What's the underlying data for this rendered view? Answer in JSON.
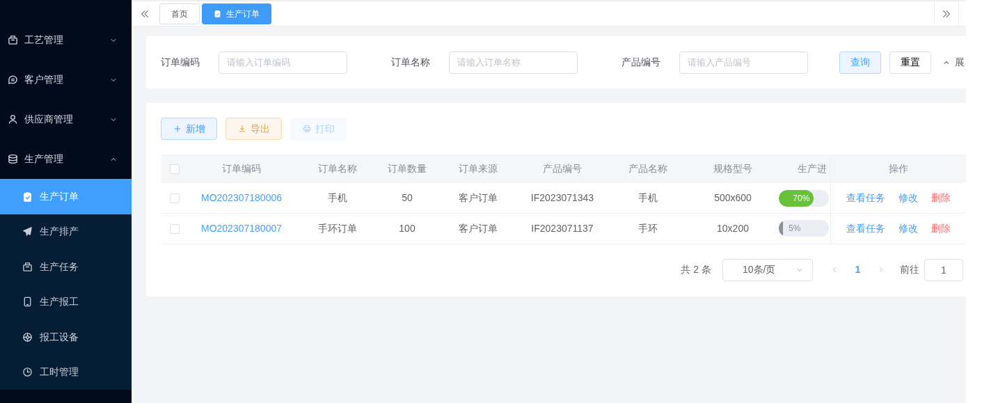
{
  "sidebar": {
    "items": [
      {
        "label": "工艺管理",
        "expanded": false
      },
      {
        "label": "客户管理",
        "expanded": false
      },
      {
        "label": "供应商管理",
        "expanded": false
      },
      {
        "label": "生产管理",
        "expanded": true,
        "children": [
          {
            "label": "生产订单",
            "selected": true
          },
          {
            "label": "生产排产",
            "selected": false
          },
          {
            "label": "生产任务",
            "selected": false
          },
          {
            "label": "生产报工",
            "selected": false
          },
          {
            "label": "报工设备",
            "selected": false
          },
          {
            "label": "工时管理",
            "selected": false
          }
        ]
      }
    ]
  },
  "tabs": [
    {
      "label": "首页",
      "selected": false
    },
    {
      "label": "生产订单",
      "selected": true
    }
  ],
  "search": {
    "fields": [
      {
        "label": "订单编码",
        "placeholder": "请输入订单编码"
      },
      {
        "label": "订单名称",
        "placeholder": "请输入订单名称"
      },
      {
        "label": "产品编号",
        "placeholder": "请输入产品编号"
      }
    ],
    "buttons": [
      {
        "label": "查询",
        "kind": "primary"
      },
      {
        "label": "重置",
        "kind": "default"
      }
    ],
    "toggle": "展"
  },
  "toolbar": [
    {
      "label": "新增",
      "kind": "add",
      "disabled": false
    },
    {
      "label": "导出",
      "kind": "export",
      "disabled": false
    },
    {
      "label": "打印",
      "kind": "print",
      "disabled": true
    }
  ],
  "table": {
    "all_selected": false,
    "columns": [
      "订单编码",
      "订单名称",
      "订单数量",
      "订单来源",
      "产品编号",
      "产品名称",
      "规格型号",
      "生产进",
      "操作"
    ],
    "rows": [
      {
        "selected": false,
        "code": "MO202307180006",
        "name": "手机",
        "quantity": "50",
        "source": "客户订单",
        "product_code": "IF2023071343",
        "product_name": "手机",
        "spec": "500x600",
        "progress": {
          "level": 0.7,
          "reading": "70%"
        },
        "actions": [
          {
            "label": "查看任务",
            "kind": "link"
          },
          {
            "label": "修改",
            "kind": "link"
          },
          {
            "label": "删除",
            "kind": "danger"
          }
        ]
      },
      {
        "selected": false,
        "code": "MO202307180007",
        "name": "手环订单",
        "quantity": "100",
        "source": "客户订单",
        "product_code": "IF2023071137",
        "product_name": "手环",
        "spec": "10x200",
        "progress": {
          "level": 0.05,
          "reading": "5%"
        },
        "actions": [
          {
            "label": "查看任务",
            "kind": "link"
          },
          {
            "label": "修改",
            "kind": "link"
          },
          {
            "label": "删除",
            "kind": "danger"
          }
        ]
      }
    ]
  },
  "pagination": {
    "total": "共 2 条",
    "page_size": "10条/页",
    "pages": [
      {
        "label": "1",
        "selected": true
      }
    ],
    "goto_label": "前往",
    "goto_value": "1"
  }
}
